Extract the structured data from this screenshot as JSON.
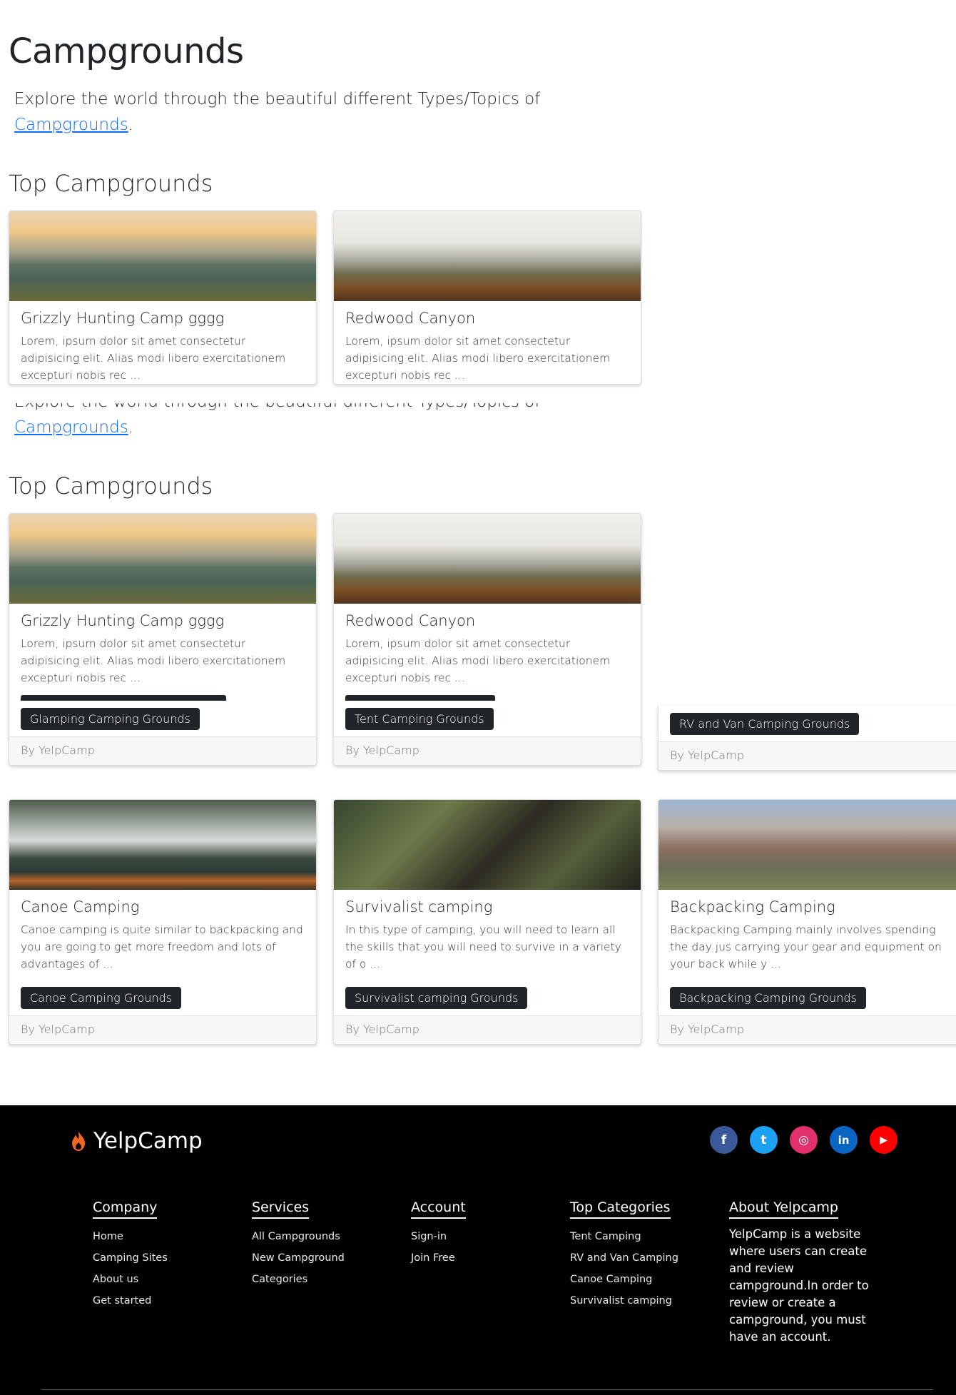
{
  "page": {
    "title": "Campgrounds",
    "intro_text": "Explore the world through the beautiful different Types/Topics of",
    "intro_link": "Campgrounds",
    "intro_period": ".",
    "section_title": "Top Campgrounds"
  },
  "cards": [
    {
      "title": "Grizzly Hunting Camp gggg",
      "text": "Lorem, ipsum dolor sit amet consectetur adipisicing elit. Alias modi libero exercitationem excepturi nobis rec ...",
      "button": "Glamping Camping Grounds",
      "footer": "By YelpCamp"
    },
    {
      "title": "Redwood Canyon",
      "text": "Lorem, ipsum dolor sit amet consectetur adipisicing elit. Alias modi libero exercitationem excepturi nobis rec ...",
      "button": "Tent Camping Grounds",
      "footer": "By YelpCamp"
    },
    {
      "title": "",
      "text": "",
      "button": "RV and Van Camping Grounds",
      "footer": "By YelpCamp"
    },
    {
      "title": "Canoe Camping",
      "text": "Canoe camping is quite similar to backpacking and you are going to get more freedom and lots of advantages of ...",
      "button": "Canoe Camping Grounds",
      "footer": "By YelpCamp"
    },
    {
      "title": "Survivalist camping",
      "text": "In this type of camping, you will need to learn all the skills that you will need to survive in a variety of o ...",
      "button": "Survivalist camping Grounds",
      "footer": "By YelpCamp"
    },
    {
      "title": "Backpacking Camping",
      "text": "Backpacking Camping mainly involves spending the day jus carrying your gear and equipment on your back while y ...",
      "button": "Backpacking Camping Grounds",
      "footer": "By YelpCamp"
    }
  ],
  "footer": {
    "brand": "YelpCamp",
    "socials": [
      {
        "icon": "facebook-icon",
        "glyph": "f",
        "color": "#3b5998"
      },
      {
        "icon": "twitter-icon",
        "glyph": "t",
        "color": "#1da1f2"
      },
      {
        "icon": "instagram-icon",
        "glyph": "◎",
        "color": "#e1306c"
      },
      {
        "icon": "linkedin-icon",
        "glyph": "in",
        "color": "#0a66c2"
      },
      {
        "icon": "youtube-icon",
        "glyph": "▶",
        "color": "#ff0000"
      }
    ],
    "columns": {
      "company": {
        "title": "Company",
        "links": [
          "Home",
          "Camping Sites",
          "About us",
          "Get started"
        ]
      },
      "services": {
        "title": "Services",
        "links": [
          "All Campgrounds",
          "New Campground",
          "Categories"
        ]
      },
      "account": {
        "title": "Account",
        "links": [
          "Sign-in",
          "Join Free"
        ]
      },
      "categories": {
        "title": "Top Categories",
        "links": [
          "Tent Camping",
          "RV and Van Camping",
          "Canoe Camping",
          "Survivalist camping"
        ]
      },
      "about": {
        "title": "About Yelpcamp",
        "text": "YelpCamp is a website where users can create and review campground.In order to review or create a campground, you must have an account."
      }
    }
  },
  "colors": {
    "button": "#212529",
    "link": "#0d6efd",
    "flame": "#f26522"
  }
}
